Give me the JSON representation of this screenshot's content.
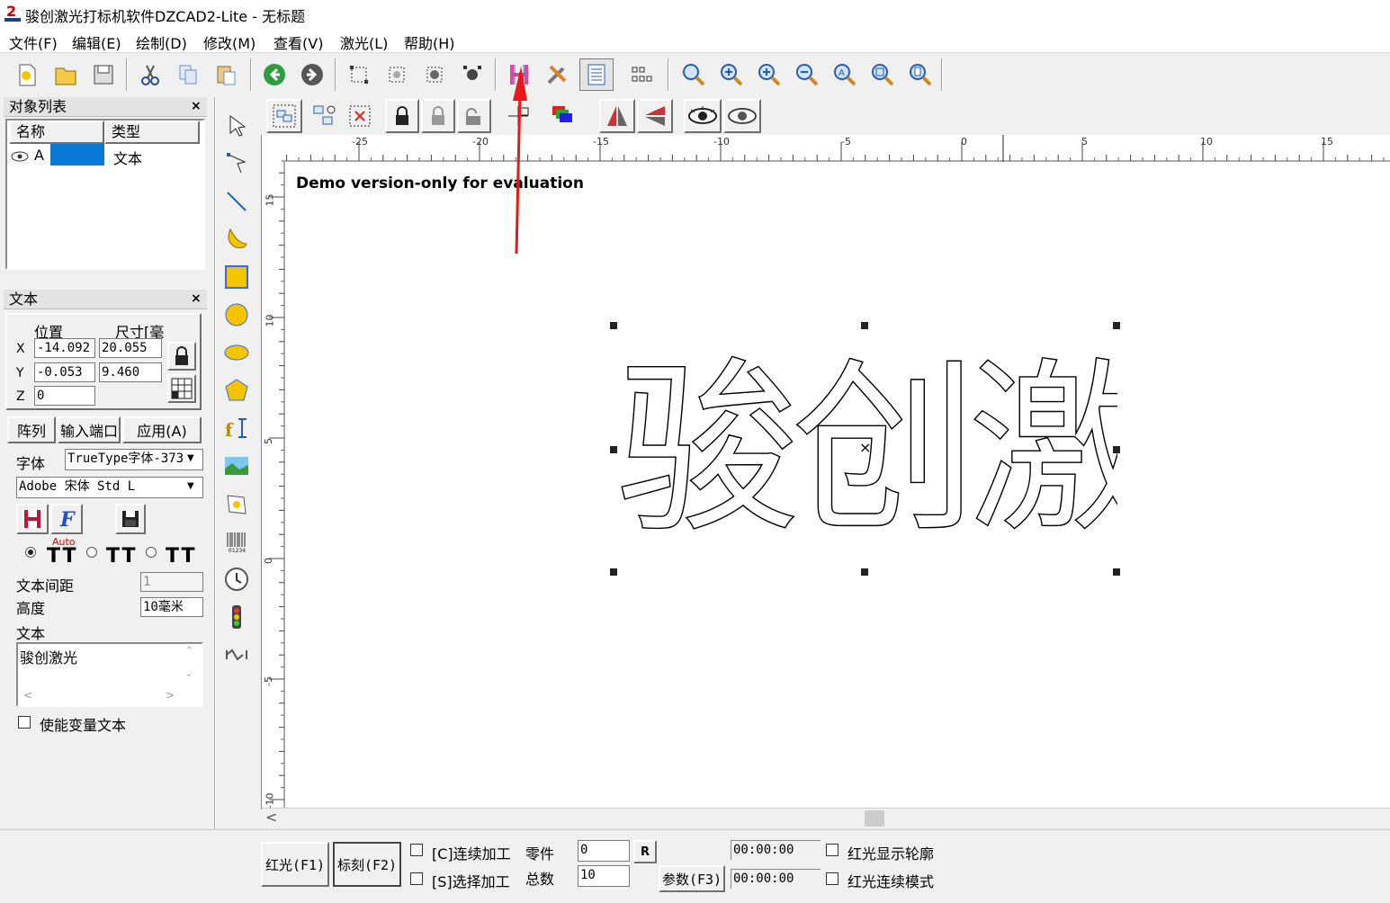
{
  "window": {
    "title": "骏创激光打标机软件DZCAD2-Lite  - 无标题"
  },
  "menu": [
    {
      "label": "文件(F)"
    },
    {
      "label": "编辑(E)"
    },
    {
      "label": "绘制(D)"
    },
    {
      "label": "修改(M)"
    },
    {
      "label": "查看(V)"
    },
    {
      "label": "激光(L)"
    },
    {
      "label": "帮助(H)"
    }
  ],
  "toolbar": {
    "icons": [
      "new-file-icon",
      "open-folder-icon",
      "save-icon",
      "cut-icon",
      "copy-icon",
      "paste-icon",
      "back-icon",
      "forward-icon",
      "node-select-icon",
      "node-edit-icon",
      "node-move-icon",
      "node-delete-icon",
      "hatch-icon",
      "tools-icon",
      "params-icon",
      "array-icon",
      "zoom-icon",
      "zoom-in-icon",
      "zoom-plus-icon",
      "zoom-minus-icon",
      "zoom-all-icon",
      "zoom-select-icon",
      "zoom-page-icon"
    ]
  },
  "object_list": {
    "title": "对象列表",
    "columns": [
      "名称",
      "类型"
    ],
    "rows": [
      {
        "name": "A",
        "type": "文本"
      }
    ]
  },
  "text_panel": {
    "title": "文本",
    "position_label": "位置",
    "size_label": "尺寸[毫",
    "x_label": "X",
    "y_label": "Y",
    "z_label": "Z",
    "x_pos": "-14.092",
    "x_size": "20.055",
    "y_pos": "-0.053",
    "y_size": "9.460",
    "z_pos": "0",
    "array_button": "阵列",
    "input_port_button": "输入端口",
    "apply_button": "应用(A)",
    "font_label": "字体",
    "font_type": "TrueType字体-373",
    "font_name": "Adobe 宋体 Std L",
    "auto_label": "Auto",
    "spacing_label": "文本间距",
    "spacing_value": "1",
    "height_label": "高度",
    "height_value": "10毫米",
    "text_label": "文本",
    "text_value": "骏创激光",
    "variable_text_label": "使能变量文本"
  },
  "canvas": {
    "watermark": "Demo version-only for evaluation",
    "display_text": "骏创激光",
    "ruler_x_labels": [
      "-25",
      "-20",
      "-15",
      "-10",
      "-5",
      "0",
      "5",
      "10",
      "15"
    ],
    "ruler_y_labels": [
      "15",
      "10",
      "5",
      "0",
      "-5",
      "-10"
    ]
  },
  "bottom": {
    "red_light_button": "红光(F1)",
    "mark_button": "标刻(F2)",
    "continuous_label": "[C]连续加工",
    "select_label": "[S]选择加工",
    "parts_label": "零件",
    "parts_value": "0",
    "total_label": "总数",
    "total_value": "10",
    "reset_button": "R",
    "params_button": "参数(F3)",
    "time1": "00:00:00",
    "time2": "00:00:00",
    "outline_label": "红光显示轮廓",
    "continuous_mode_label": "红光连续模式"
  }
}
